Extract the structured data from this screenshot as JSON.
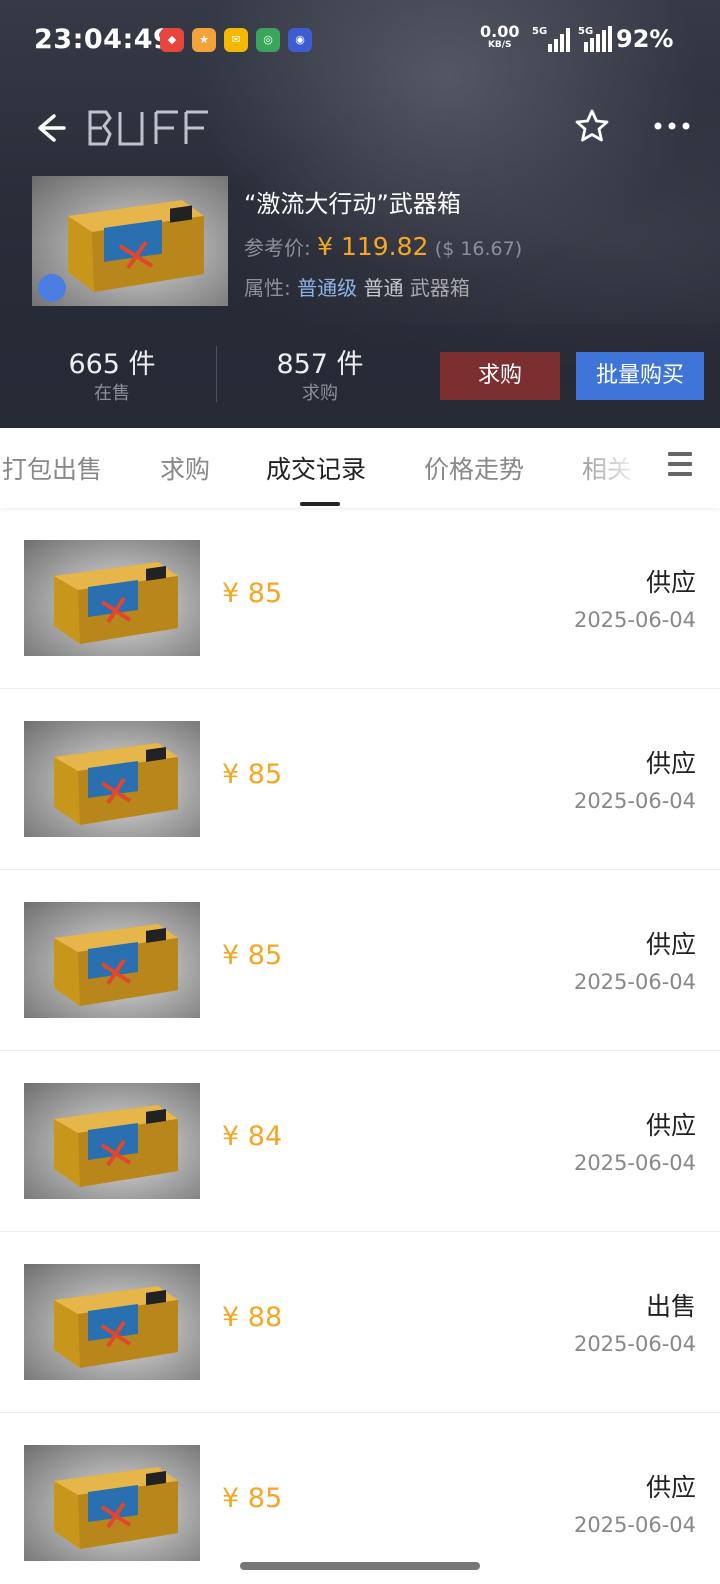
{
  "status_bar": {
    "time": "23:04:49",
    "net_speed": "0.00",
    "net_unit": "KB/S",
    "sim1_label": "5G",
    "sim2_label": "5G",
    "battery": "92%"
  },
  "nav": {
    "logo_text": "BUFF"
  },
  "item": {
    "title": "“激流大行动”武器箱",
    "ref_label": "参考价:",
    "ref_price": "¥ 119.82",
    "ref_usd": "($ 16.67)",
    "attr_label": "属性:",
    "attr_1": "普通级",
    "attr_2": "普通",
    "attr_3": "武器箱"
  },
  "stats": {
    "on_sale_count": "665 件",
    "on_sale_label": "在售",
    "buy_req_count": "857 件",
    "buy_req_label": "求购"
  },
  "buttons": {
    "buy_request": "求购",
    "bulk_buy": "批量购买"
  },
  "tabs": [
    {
      "label": "打包出售",
      "active": false
    },
    {
      "label": "求购",
      "active": false
    },
    {
      "label": "成交记录",
      "active": true
    },
    {
      "label": "价格走势",
      "active": false
    },
    {
      "label": "相关",
      "active": false
    }
  ],
  "records": [
    {
      "price": "¥ 85",
      "type": "供应",
      "date": "2025-06-04"
    },
    {
      "price": "¥ 85",
      "type": "供应",
      "date": "2025-06-04"
    },
    {
      "price": "¥ 85",
      "type": "供应",
      "date": "2025-06-04"
    },
    {
      "price": "¥ 84",
      "type": "供应",
      "date": "2025-06-04"
    },
    {
      "price": "¥ 88",
      "type": "出售",
      "date": "2025-06-04"
    },
    {
      "price": "¥ 85",
      "type": "供应",
      "date": "2025-06-04"
    }
  ],
  "colors": {
    "accent_price": "#f5a623",
    "buy_request_btn": "#7b2f31",
    "bulk_buy_btn": "#3f75d6"
  }
}
